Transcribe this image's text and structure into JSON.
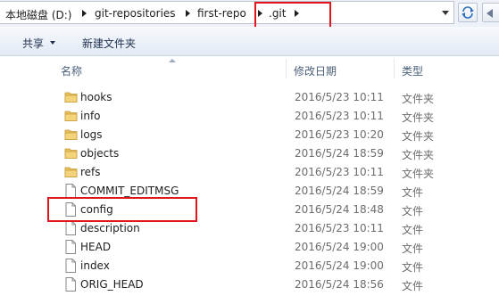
{
  "address": {
    "crumbs": [
      "本地磁盘 (D:)",
      "git-repositories",
      "first-repo",
      ".git"
    ],
    "refresh_icon": "refresh-icon",
    "back_icon": "back-icon"
  },
  "toolbar": {
    "share_label": "共享",
    "new_folder_label": "新建文件夹"
  },
  "columns": {
    "name": "名称",
    "date": "修改日期",
    "type": "类型"
  },
  "files": [
    {
      "name": "hooks",
      "date": "2016/5/23 10:11",
      "type": "文件夹",
      "icon": "folder-icon"
    },
    {
      "name": "info",
      "date": "2016/5/23 10:11",
      "type": "文件夹",
      "icon": "folder-icon"
    },
    {
      "name": "logs",
      "date": "2016/5/23 10:20",
      "type": "文件夹",
      "icon": "folder-icon"
    },
    {
      "name": "objects",
      "date": "2016/5/24 18:59",
      "type": "文件夹",
      "icon": "folder-icon"
    },
    {
      "name": "refs",
      "date": "2016/5/23 10:11",
      "type": "文件夹",
      "icon": "folder-icon"
    },
    {
      "name": "COMMIT_EDITMSG",
      "date": "2016/5/24 18:59",
      "type": "文件",
      "icon": "file-icon"
    },
    {
      "name": "config",
      "date": "2016/5/24 18:48",
      "type": "文件",
      "icon": "file-icon"
    },
    {
      "name": "description",
      "date": "2016/5/23 10:11",
      "type": "文件",
      "icon": "file-icon"
    },
    {
      "name": "HEAD",
      "date": "2016/5/24 19:00",
      "type": "文件",
      "icon": "file-icon"
    },
    {
      "name": "index",
      "date": "2016/5/24 19:00",
      "type": "文件",
      "icon": "file-icon"
    },
    {
      "name": "ORIG_HEAD",
      "date": "2016/5/24 18:56",
      "type": "文件",
      "icon": "file-icon"
    }
  ],
  "colors": {
    "highlight": "#e0161c",
    "folder": "#e8c15a"
  }
}
